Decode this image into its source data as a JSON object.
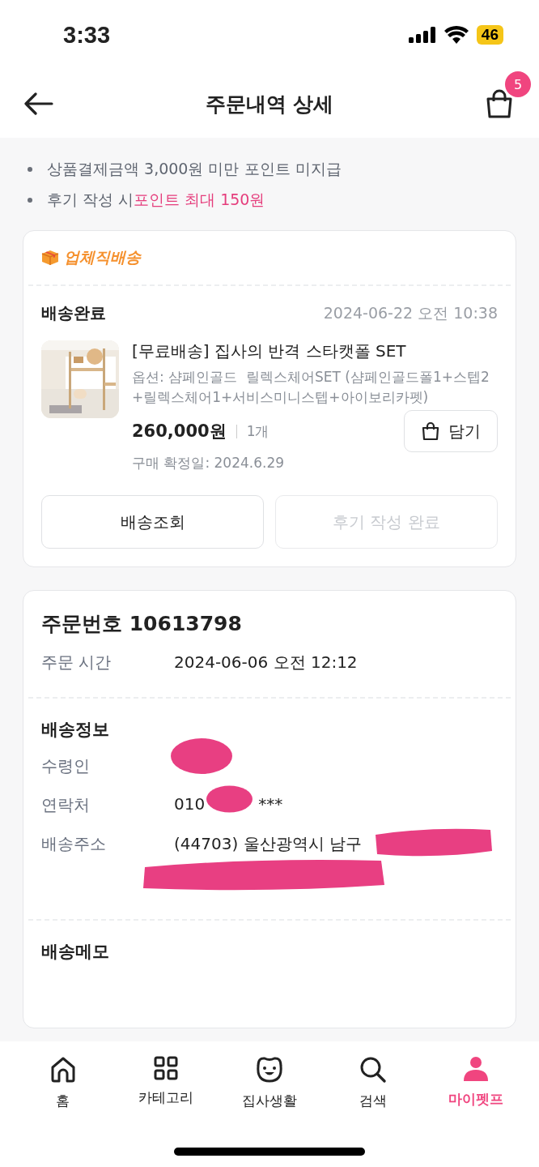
{
  "status_bar": {
    "time": "3:33",
    "battery": "46"
  },
  "header": {
    "title": "주문내역 상세",
    "cart_badge": "5"
  },
  "notices": [
    {
      "text": "상품결제금액 3,000원 미만 포인트 미지급"
    },
    {
      "text": "후기 작성 시 ",
      "highlight": "포인트 최대 150원"
    }
  ],
  "shipment": {
    "shipping_type": "업체직배송",
    "status": "배송완료",
    "date": "2024-06-22 오전 10:38",
    "product": {
      "kind": "picture",
      "name": "[무료배송] 집사의 반격 스타캣폴 SET",
      "option": "옵션: 샴페인골드  릴렉스체어SET (샴페인골드폴1+스텝2+릴렉스체어1+서비스미니스텝+아이보리카펫)",
      "price": "260,000원",
      "quantity": "1개",
      "confirmed": "구매 확정일: 2024.6.29"
    },
    "cart_button": "담기",
    "actions": [
      {
        "label": "배송조회",
        "disabled": false
      },
      {
        "label": "후기 작성 완료",
        "disabled": true
      }
    ]
  },
  "order": {
    "title": "주문번호 10613798",
    "rows": [
      {
        "label": "주문 시간",
        "value": "2024-06-06 오전 12:12"
      }
    ]
  },
  "delivery": {
    "title": "배송정보",
    "rows": [
      {
        "label": "수령인",
        "kind": "blot"
      },
      {
        "label": "연락처",
        "value": "010",
        "value_end": "***",
        "kind": "blot"
      },
      {
        "label": "배송주소",
        "value": "(44703) 울산광역시 남구",
        "kind": "smear"
      }
    ]
  },
  "memo": {
    "title": "배송메모"
  },
  "nav": [
    {
      "label": "홈",
      "kind": "home",
      "selected": false
    },
    {
      "label": "카테고리",
      "kind": "grid",
      "selected": false
    },
    {
      "label": "집사생활",
      "kind": "face",
      "selected": false
    },
    {
      "label": "검색",
      "kind": "search",
      "selected": false
    },
    {
      "label": "마이펫프",
      "kind": "person",
      "selected": true
    }
  ]
}
